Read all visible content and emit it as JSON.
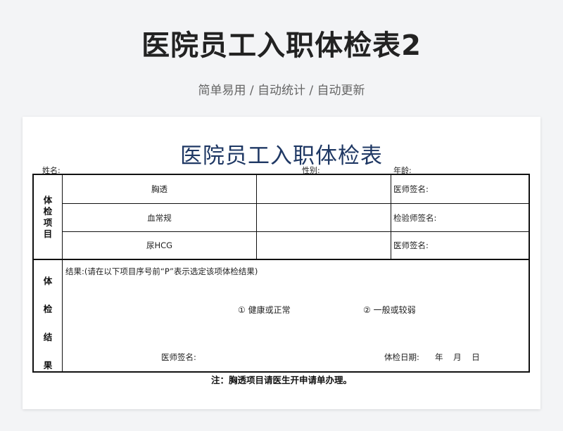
{
  "header": {
    "title": "医院员工入职体检表2",
    "subtitle": "简单易用 / 自动统计 / 自动更新"
  },
  "form": {
    "title": "医院员工入职体检表",
    "fields": {
      "name_label": "姓名:",
      "gender_label": "性别:",
      "age_label": "年龄:"
    },
    "exam_section": {
      "label_chars": [
        "体",
        "检",
        "项",
        "目"
      ],
      "rows": [
        {
          "item": "胸透",
          "signer_label": "医师签名:"
        },
        {
          "item": "血常规",
          "signer_label": "检验师签名:"
        },
        {
          "item": "尿HCG",
          "signer_label": "医师签名:"
        }
      ]
    },
    "result_section": {
      "label_chars": [
        "体",
        "检",
        "结",
        "果"
      ],
      "instruction": "结果:(请在以下项目序号前“P”表示选定该项体检结果)",
      "option1": "① 健康或正常",
      "option2": "② 一般或较弱",
      "doctor_sign_label": "医师签名:",
      "date_label": "体检日期:",
      "date_units": "年    月    日"
    },
    "note": "注：胸透项目请医生开申请单办理。"
  }
}
